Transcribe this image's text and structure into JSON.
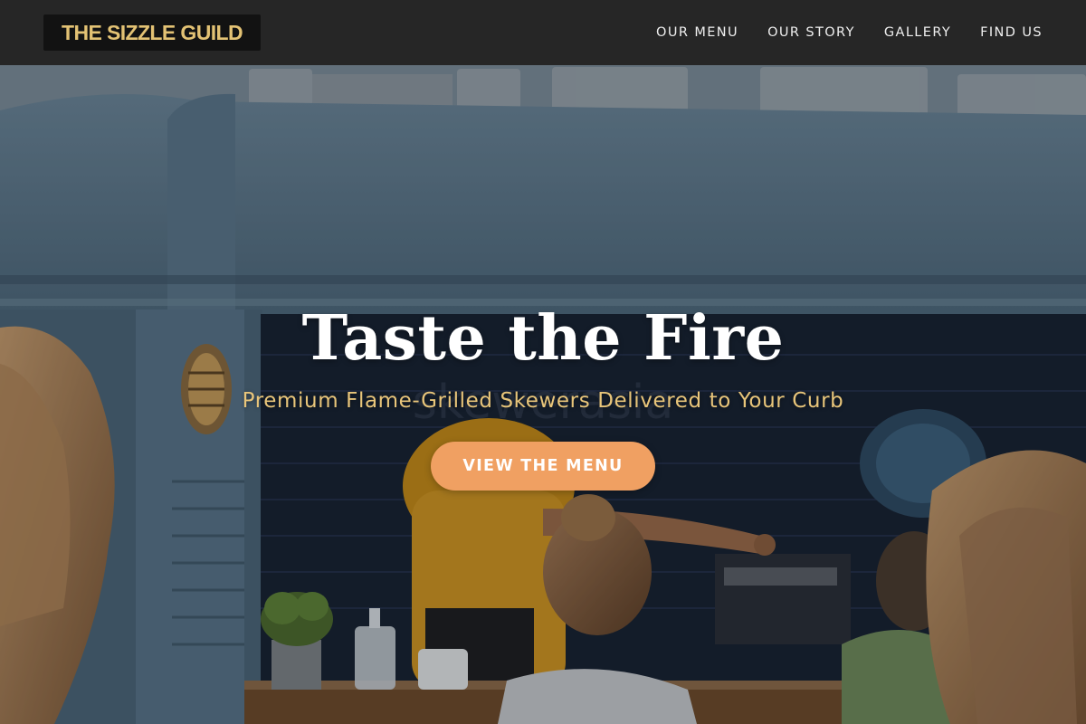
{
  "brand": {
    "name": "THE SIZZLE GUILD",
    "accent_color": "#e3c274"
  },
  "nav": {
    "items": [
      {
        "label": "OUR MENU"
      },
      {
        "label": "OUR STORY"
      },
      {
        "label": "GALLERY"
      },
      {
        "label": "FIND US"
      }
    ]
  },
  "hero": {
    "title": "Taste the Fire",
    "subtitle": "Premium Flame-Grilled Skewers Delivered to Your Curb",
    "cta_label": "VIEW THE MENU",
    "cta_color": "#f0a062",
    "subtitle_color": "#e8c57a",
    "background_image": "food-truck-photo"
  }
}
